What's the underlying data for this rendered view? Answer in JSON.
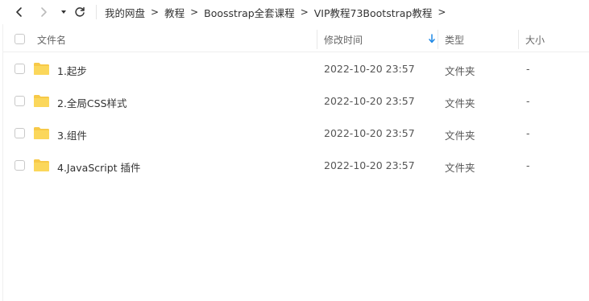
{
  "toolbar": {
    "back_icon": "chevron-left-icon",
    "forward_icon": "chevron-right-icon",
    "dropdown_icon": "caret-down-icon",
    "refresh_icon": "refresh-icon"
  },
  "breadcrumb": {
    "items": [
      "我的网盘",
      "教程",
      "Boosstrap全套课程",
      "VIP教程73Bootstrap教程"
    ],
    "separator": ">"
  },
  "table": {
    "columns": {
      "name": "文件名",
      "modified": "修改时间",
      "type": "类型",
      "size": "大小"
    },
    "sort_icon": "arrow-down-icon",
    "accent_color": "#1e88e5",
    "folder_color": "#f7c948",
    "rows": [
      {
        "name": "1.起步",
        "modified": "2022-10-20 23:57",
        "type": "文件夹",
        "size": "-"
      },
      {
        "name": "2.全局CSS样式",
        "modified": "2022-10-20 23:57",
        "type": "文件夹",
        "size": "-"
      },
      {
        "name": "3.组件",
        "modified": "2022-10-20 23:57",
        "type": "文件夹",
        "size": "-"
      },
      {
        "name": "4.JavaScript 插件",
        "modified": "2022-10-20 23:57",
        "type": "文件夹",
        "size": "-"
      }
    ]
  }
}
